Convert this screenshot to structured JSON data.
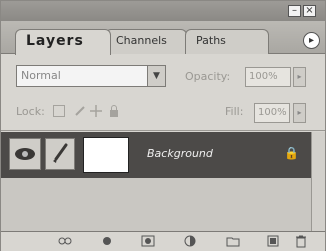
{
  "window": {
    "minimize_icon": "minimize-icon",
    "close_icon": "close-icon",
    "minimize_glyph": "–",
    "close_glyph": "×"
  },
  "tabs": [
    {
      "label": "Layers",
      "active": true
    },
    {
      "label": "Channels",
      "active": false
    },
    {
      "label": "Paths",
      "active": false
    }
  ],
  "panel_menu_glyph": "▸",
  "blend_mode": {
    "value": "Normal",
    "arrow": "▼"
  },
  "opacity": {
    "label": "Opacity:",
    "value": "100%",
    "spin": "▸"
  },
  "lock": {
    "label": "Lock:"
  },
  "fill": {
    "label": "Fill:",
    "value": "100%",
    "spin": "▸"
  },
  "layers": [
    {
      "name": "Background",
      "visible": true,
      "locked": true,
      "lock_glyph": "🔒"
    }
  ],
  "colors": {
    "selected_row": "#4c4a48",
    "panel": "#d8d6d1"
  }
}
